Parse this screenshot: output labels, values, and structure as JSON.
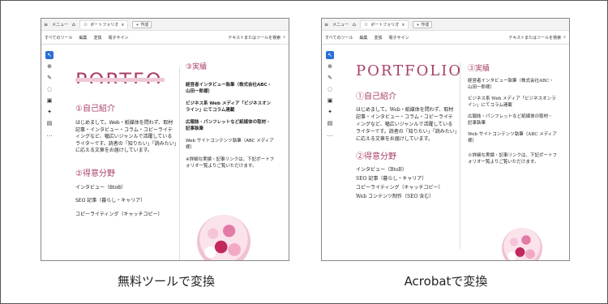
{
  "captions": {
    "left": "無料ツールで変換",
    "right": "Acrobatで変換"
  },
  "app": {
    "tabbar": {
      "menu": "メニュー",
      "tab_title": "ポートフォリオ",
      "new_button": "+ 作成"
    },
    "menubar": {
      "items": [
        "すべてのツール",
        "編集",
        "変換",
        "電子サイン"
      ],
      "search": "テキストまたはツールを検索"
    }
  },
  "left_doc": {
    "title": "PORTFO",
    "h1": "①自己紹介",
    "intro": "はじめまして。Web・紙媒体を問わず、取材記事・インタビュー・コラム・コピーライティングなど、幅広いジャンルで活躍しているライターです。読者の「知りたい」「読みたい」に応える文章をお届けしています。",
    "h2": "②得意分野",
    "skills": [
      "インタビュー（BtoB）",
      "SEO 記事（暮らし・キャリア）",
      "コピーライティング（キャッチコピー）"
    ],
    "r_heading": "③実績",
    "r_items": [
      "経営者インタビュー執筆（株式会社ABC・山田一郎様）",
      "ビジネス系 Web メディア「ビジネスオンライン」にてコラム連載",
      "広報誌・パンフレットなど紙媒体の取材・記事執筆",
      "Web サイトコンテンツ執筆（ABC メディア様）",
      "※詳細な実績・記事リンクは、下記ポートフォリオ一覧よりご覧いただけます。"
    ]
  },
  "right_doc": {
    "title": "PORTFOLIO",
    "h1": "①自己紹介",
    "intro": "はじめまして。Web・紙媒体を問わず、取材記事・インタビュー・コラム・コピーライティングなど、幅広いジャンルで活躍しているライターです。読者の「知りたい」「読みたい」に応える文章をお届けしています。",
    "h2": "②得意分野",
    "skills": [
      "インタビュー（BtoB）",
      "SEO 記事（暮らし・キャリア）",
      "コピーライティング（キャッチコピー）",
      "Web コンテンツ制作（SEO 含む）"
    ],
    "r_heading": "③実績",
    "r_items": [
      "経営者インタビュー執筆（株式会社ABC・山田一郎様）",
      "ビジネス系 Web メディア「ビジネスオンライン」にてコラム連載",
      "広報誌・パンフレットなど紙媒体の取材・記事執筆",
      "Web サイトコンテンツ執筆（ABC メディア様）",
      "※詳細な実績・記事リンクは、下記ポートフォリオ一覧よりご覧いただけます。"
    ]
  }
}
